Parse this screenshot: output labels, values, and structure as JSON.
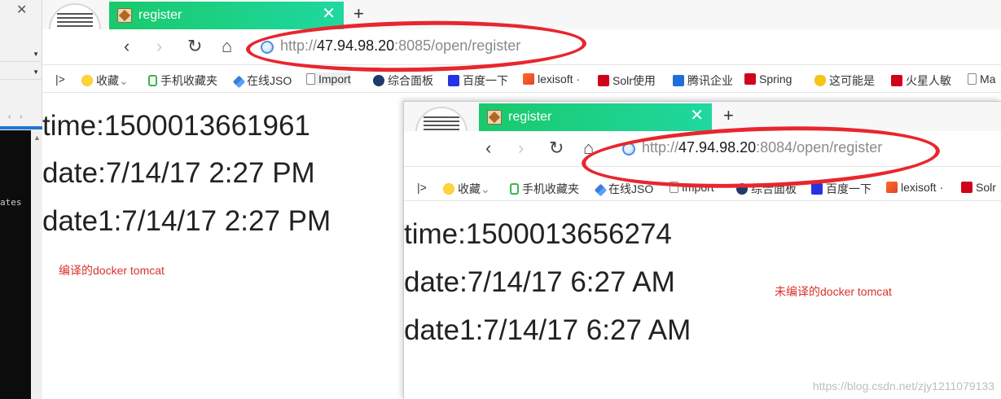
{
  "background_app": {
    "close_glyph": "✕",
    "arrows": "‹ ›",
    "console_text": "ates",
    "scroll_up": "▲"
  },
  "browser_front": {
    "tab_title": "register",
    "tab_close": "✕",
    "new_tab": "+",
    "address": {
      "scheme": "http://",
      "host": "47.94.98.20",
      "port_path": ":8085/open/register"
    },
    "bookmarks": [
      "收藏",
      "手机收藏夹",
      "在线JSO",
      "Import",
      "综合面板",
      "百度一下",
      "lexisoft ·",
      "Solr使用",
      "腾讯企业",
      "Spring",
      "这可能是",
      "火星人敏",
      "Ma"
    ],
    "content": {
      "time": "time:1500013661961",
      "date": "date:7/14/17 2:27 PM",
      "date1": "date1:7/14/17 2:27 PM"
    },
    "note": "编译的docker tomcat"
  },
  "browser_back": {
    "tab_title": "register",
    "tab_close": "✕",
    "new_tab": "+",
    "address": {
      "scheme": "http://",
      "host": "47.94.98.20",
      "port_path": ":8084/open/register"
    },
    "bookmarks": [
      "收藏",
      "手机收藏夹",
      "在线JSO",
      "Import",
      "综合面板",
      "百度一下",
      "lexisoft ·",
      "Solr"
    ],
    "content": {
      "time": "time:1500013656274",
      "date": "date:7/14/17 6:27 AM",
      "date1": "date1:7/14/17 6:27 AM"
    },
    "note": "未编译的docker tomcat"
  },
  "nav_glyphs": {
    "back": "‹",
    "forward": "›",
    "reload": "↻",
    "home": "⌂",
    "sidebar": "|>",
    "dropdown": "⌄"
  },
  "watermark": "https://blog.csdn.net/zjy1211079133",
  "colors": {
    "tab_green": "#19c96b",
    "annotation_red": "#e8262e",
    "note_red": "#d9322b",
    "address_gray": "#8a8a8a"
  }
}
